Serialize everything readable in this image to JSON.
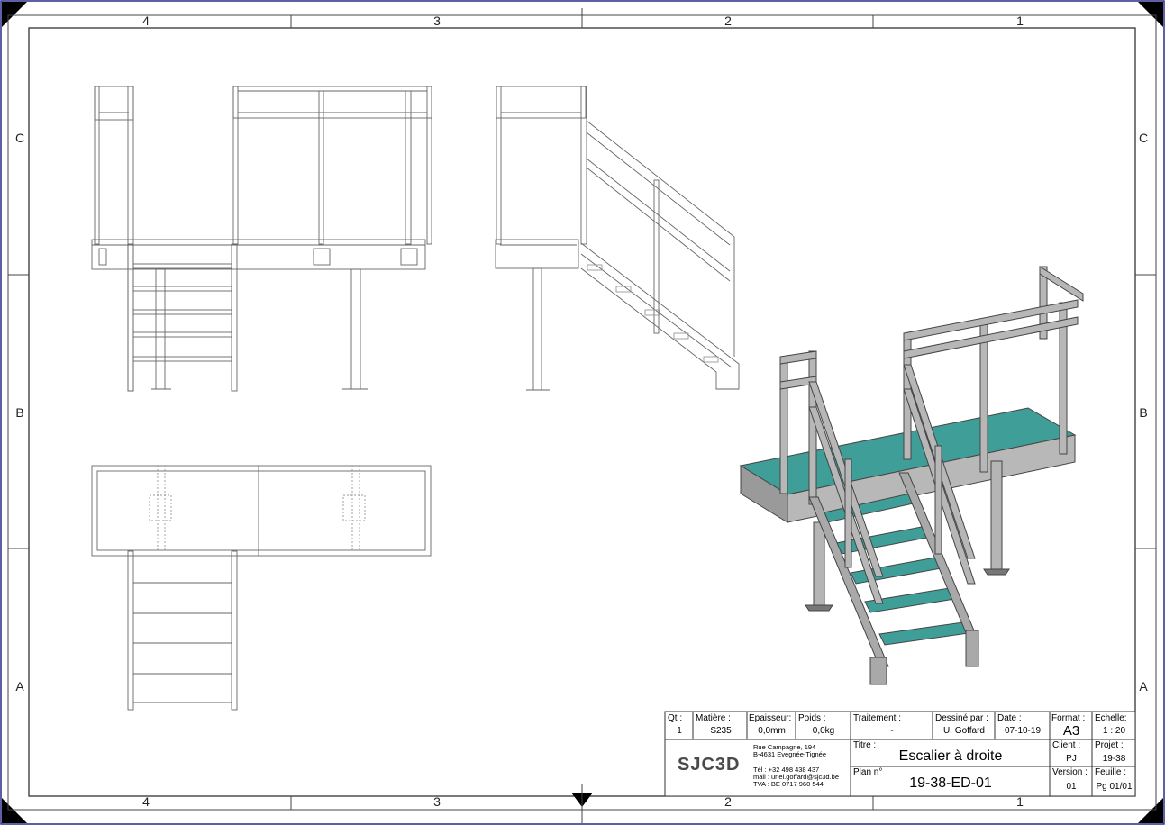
{
  "frame": {
    "column_labels": [
      "4",
      "3",
      "2",
      "1"
    ],
    "row_labels": [
      "C",
      "B",
      "A"
    ]
  },
  "title_block": {
    "qty_label": "Qt :",
    "qty_value": "1",
    "material_label": "Matière :",
    "material_value": "S235",
    "thickness_label": "Epaisseur:",
    "thickness_value": "0,0mm",
    "weight_label": "Poids :",
    "weight_value": "0,0kg",
    "treatment_label": "Traitement :",
    "treatment_value": "-",
    "drawn_by_label": "Dessiné par :",
    "drawn_by_value": "U. Goffard",
    "date_label": "Date :",
    "date_value": "07-10-19",
    "format_label": "Format :",
    "format_value": "A3",
    "scale_label": "Echelle:",
    "scale_value": "1 : 20",
    "company_logo": "SJC3D",
    "address_line1": "Rue Campagne, 194",
    "address_line2": "B-4631 Evegnée-Tignée",
    "phone": "Tél : +32 498 438 437",
    "mail": "mail : uriel.goffard@sjc3d.be",
    "vat": "TVA : BE 0717 960 544",
    "title_label": "Titre :",
    "title_value": "Escalier à droite",
    "client_label": "Client :",
    "client_value": "PJ",
    "project_label": "Projet :",
    "project_value": "19-38",
    "plan_label": "Plan n°",
    "plan_value": "19-38-ED-01",
    "version_label": "Version :",
    "version_value": "01",
    "sheet_label": "Feuille :",
    "sheet_value": "Pg 01/01"
  },
  "colors": {
    "tread": "#3a9e98",
    "steel": "#a8a8a8",
    "line": "#555555"
  }
}
